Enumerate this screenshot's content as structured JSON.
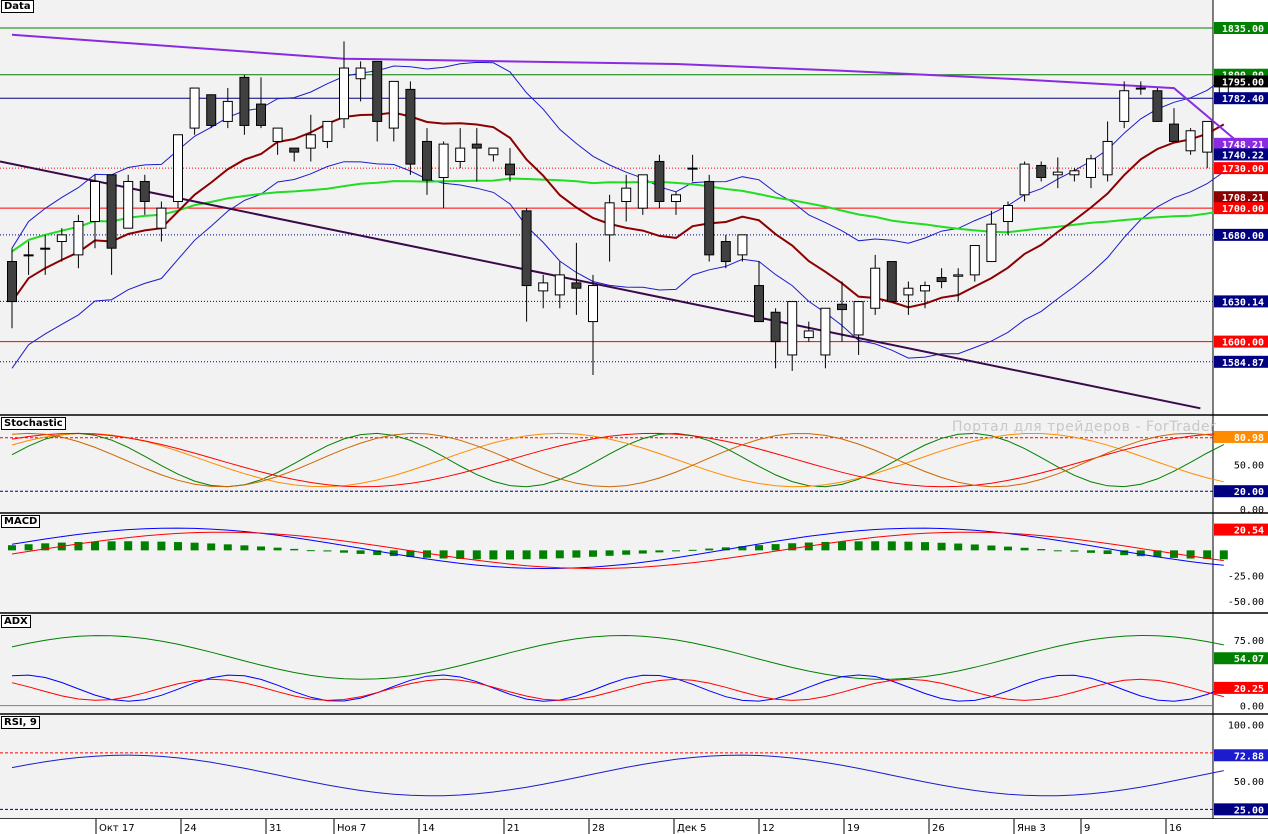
{
  "panels": {
    "price": "Data",
    "stochastic": "Stochastic",
    "macd": "MACD",
    "adx": "ADX",
    "rsi": "RSI, 9"
  },
  "watermark": "Портал для трейдеров - ForTrader",
  "x_labels": [
    "Окт 17",
    "24",
    "31",
    "Ноя 7",
    "14",
    "21",
    "28",
    "Дек 5",
    "12",
    "19",
    "26",
    "Янв 3",
    "9",
    "16"
  ],
  "colors": {
    "background": "#f2f2f2",
    "bull": "#ffffff",
    "bear": "#404040",
    "ma_purple": "#8a2be2",
    "ma_green": "#22dd22",
    "ma_darkred": "#8b0000",
    "bollinger": "#1c1ccc",
    "trendline": "#3a0a4a",
    "level_red": "#ff0000",
    "level_green": "#008000",
    "level_blue": "#000080"
  },
  "chart_data": [
    {
      "type": "candlestick",
      "panel": "price",
      "ylim": [
        1545,
        1850
      ],
      "horizontal_levels": [
        {
          "value": 1835.0,
          "color": "green"
        },
        {
          "value": 1800.0,
          "color": "green"
        },
        {
          "value": 1782.4,
          "color": "blue"
        },
        {
          "value": 1730.0,
          "color": "red",
          "dotted": true
        },
        {
          "value": 1700.0,
          "color": "red"
        },
        {
          "value": 1680.0,
          "color": "blue",
          "dotted": true
        },
        {
          "value": 1630.14,
          "color": "blue",
          "dotted": true
        },
        {
          "value": 1600.0,
          "color": "red"
        },
        {
          "value": 1584.87,
          "color": "blue",
          "dotted": true
        }
      ],
      "price_labels": [
        {
          "text": "1835.00",
          "value": 1835.0,
          "bg": "#008000"
        },
        {
          "text": "1800.00",
          "value": 1800.0,
          "bg": "#008000"
        },
        {
          "text": "1795.00",
          "value": 1795.0,
          "bg": "#000000"
        },
        {
          "text": "1782.40",
          "value": 1782.4,
          "bg": "#000080"
        },
        {
          "text": "1748.21",
          "value": 1748.21,
          "bg": "#8a2be2"
        },
        {
          "text": "1740.22",
          "value": 1740.22,
          "bg": "#000080"
        },
        {
          "text": "1730.00",
          "value": 1730.0,
          "bg": "#ff0000"
        },
        {
          "text": "1708.21",
          "value": 1708.21,
          "bg": "#8b0000"
        },
        {
          "text": "1700.00",
          "value": 1700.0,
          "bg": "#ff0000"
        },
        {
          "text": "1680.00",
          "value": 1680.0,
          "bg": "#000080"
        },
        {
          "text": "1630.14",
          "value": 1630.14,
          "bg": "#000080"
        },
        {
          "text": "1600.00",
          "value": 1600.0,
          "bg": "#ff0000"
        },
        {
          "text": "1584.87",
          "value": 1584.87,
          "bg": "#000080"
        }
      ],
      "candles": [
        [
          1660,
          1670,
          1610,
          1630
        ],
        [
          1665,
          1675,
          1650,
          1665
        ],
        [
          1670,
          1680,
          1650,
          1670
        ],
        [
          1675,
          1685,
          1660,
          1680
        ],
        [
          1665,
          1695,
          1655,
          1690
        ],
        [
          1690,
          1725,
          1670,
          1720
        ],
        [
          1725,
          1725,
          1650,
          1670
        ],
        [
          1685,
          1725,
          1685,
          1720
        ],
        [
          1720,
          1725,
          1695,
          1705
        ],
        [
          1685,
          1705,
          1675,
          1700
        ],
        [
          1705,
          1755,
          1700,
          1755
        ],
        [
          1760,
          1790,
          1755,
          1790
        ],
        [
          1785,
          1785,
          1760,
          1762
        ],
        [
          1765,
          1790,
          1760,
          1780
        ],
        [
          1798,
          1800,
          1755,
          1762
        ],
        [
          1778,
          1798,
          1760,
          1762
        ],
        [
          1750,
          1760,
          1740,
          1760
        ],
        [
          1745,
          1745,
          1735,
          1742
        ],
        [
          1745,
          1770,
          1735,
          1755
        ],
        [
          1750,
          1760,
          1745,
          1765
        ],
        [
          1767,
          1825,
          1760,
          1805
        ],
        [
          1797,
          1810,
          1780,
          1805
        ],
        [
          1810,
          1810,
          1750,
          1765
        ],
        [
          1760,
          1795,
          1750,
          1795
        ],
        [
          1789,
          1795,
          1725,
          1733
        ],
        [
          1750,
          1760,
          1710,
          1721
        ],
        [
          1723,
          1750,
          1700,
          1748
        ],
        [
          1735,
          1760,
          1730,
          1745
        ],
        [
          1748,
          1760,
          1720,
          1745
        ],
        [
          1740,
          1745,
          1735,
          1745
        ],
        [
          1733,
          1745,
          1720,
          1725
        ],
        [
          1698,
          1700,
          1615,
          1642
        ],
        [
          1638,
          1650,
          1625,
          1644
        ],
        [
          1635,
          1660,
          1625,
          1650
        ],
        [
          1644,
          1674,
          1620,
          1640
        ],
        [
          1615,
          1650,
          1575,
          1642
        ],
        [
          1680,
          1710,
          1660,
          1704
        ],
        [
          1705,
          1725,
          1690,
          1715
        ],
        [
          1700,
          1725,
          1695,
          1725
        ],
        [
          1735,
          1740,
          1700,
          1705
        ],
        [
          1705,
          1712,
          1695,
          1710
        ],
        [
          1730,
          1740,
          1720,
          1730
        ],
        [
          1720,
          1725,
          1660,
          1665
        ],
        [
          1675,
          1680,
          1655,
          1660
        ],
        [
          1665,
          1670,
          1660,
          1680
        ],
        [
          1642,
          1660,
          1615,
          1615
        ],
        [
          1622,
          1625,
          1580,
          1600
        ],
        [
          1590,
          1630,
          1578,
          1630
        ],
        [
          1603,
          1615,
          1600,
          1608
        ],
        [
          1590,
          1625,
          1580,
          1625
        ],
        [
          1628,
          1645,
          1600,
          1624
        ],
        [
          1605,
          1625,
          1590,
          1630
        ],
        [
          1625,
          1665,
          1620,
          1655
        ],
        [
          1660,
          1660,
          1630,
          1630
        ],
        [
          1635,
          1645,
          1620,
          1640
        ],
        [
          1638,
          1645,
          1625,
          1642
        ],
        [
          1648,
          1655,
          1640,
          1645
        ],
        [
          1649,
          1655,
          1630,
          1650
        ],
        [
          1650,
          1665,
          1645,
          1672
        ],
        [
          1660,
          1698,
          1660,
          1688
        ],
        [
          1690,
          1705,
          1680,
          1702
        ],
        [
          1710,
          1735,
          1705,
          1733
        ],
        [
          1732,
          1735,
          1720,
          1723
        ],
        [
          1725,
          1738,
          1715,
          1727
        ],
        [
          1725,
          1730,
          1720,
          1728
        ],
        [
          1723,
          1740,
          1715,
          1737
        ],
        [
          1725,
          1765,
          1720,
          1750
        ],
        [
          1765,
          1795,
          1760,
          1788
        ],
        [
          1790,
          1795,
          1785,
          1790
        ],
        [
          1788,
          1790,
          1765,
          1765
        ],
        [
          1763,
          1775,
          1750,
          1750
        ],
        [
          1743,
          1760,
          1740,
          1758
        ],
        [
          1742,
          1765,
          1730,
          1765
        ],
        [
          1780,
          1800,
          1780,
          1797
        ]
      ],
      "lines": {
        "ma_purple": [
          [
            0,
            1830
          ],
          [
            20,
            1812
          ],
          [
            40,
            1808
          ],
          [
            50,
            1803
          ],
          [
            60,
            1797
          ],
          [
            70,
            1790
          ],
          [
            74,
            1748
          ]
        ],
        "trendline": [
          [
            0,
            1735
          ],
          [
            74,
            1550
          ]
        ]
      }
    },
    {
      "type": "line",
      "panel": "stochastic",
      "ylim": [
        0,
        100
      ],
      "levels": [
        80,
        20
      ],
      "tick_labels": [
        "50.00",
        "0.00"
      ],
      "value_labels": [
        {
          "text": "80.98",
          "value": 80.98,
          "bg": "#ff8c00"
        },
        {
          "text": "20.00",
          "value": 20.0,
          "bg": "#000080"
        }
      ]
    },
    {
      "type": "bar+line",
      "panel": "macd",
      "ylim": [
        -58,
        32
      ],
      "tick_labels": [
        "-25.00",
        "-50.00"
      ],
      "value_labels": [
        {
          "text": "20.54",
          "value": 20.54,
          "bg": "#ff0000"
        }
      ]
    },
    {
      "type": "line",
      "panel": "adx",
      "ylim": [
        -5,
        100
      ],
      "tick_labels": [
        "75.00",
        "0.00"
      ],
      "value_labels": [
        {
          "text": "54.07",
          "value": 54.07,
          "bg": "#008000"
        },
        {
          "text": "20.25",
          "value": 20.25,
          "bg": "#ff0000"
        }
      ]
    },
    {
      "type": "line",
      "panel": "rsi",
      "ylim": [
        20,
        105
      ],
      "levels": [
        75,
        25
      ],
      "tick_labels": [
        "100.00",
        "50.00"
      ],
      "value_labels": [
        {
          "text": "72.88",
          "value": 72.88,
          "bg": "#1c1ccc"
        },
        {
          "text": "25.00",
          "value": 25.0,
          "bg": "#000080"
        }
      ]
    }
  ]
}
